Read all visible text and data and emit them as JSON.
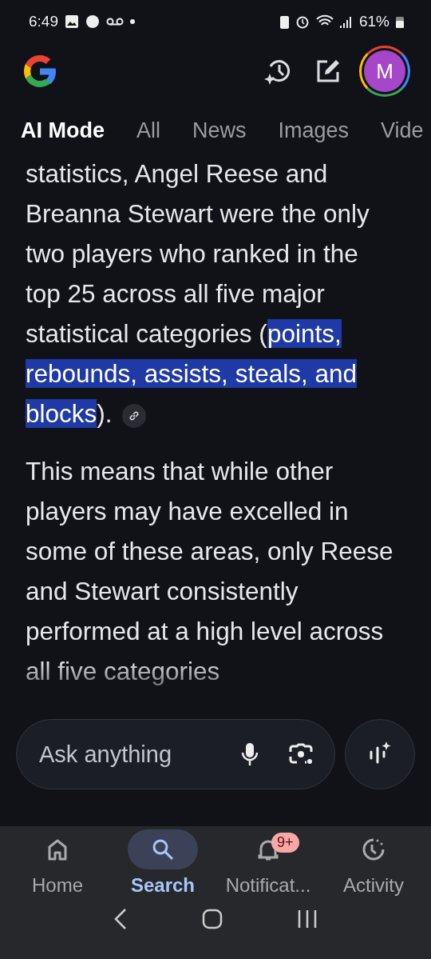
{
  "status_bar": {
    "time": "6:49",
    "battery": "61%"
  },
  "account": {
    "initial": "M"
  },
  "tabs": [
    {
      "label": "AI Mode",
      "selected": true
    },
    {
      "label": "All",
      "selected": false
    },
    {
      "label": "News",
      "selected": false
    },
    {
      "label": "Images",
      "selected": false
    },
    {
      "label": "Vide",
      "selected": false
    }
  ],
  "answer": {
    "paragraphs": [
      {
        "before": "statistics, Angel Reese and Breanna Stewart were the only two players who ranked in the top 25 across all five major statistical categories (",
        "highlight": "points, rebounds, assists, steals, and blocks",
        "after": ").",
        "link": true
      },
      {
        "before": "This means that while other players may have excelled in some of these areas, only Reese and Stewart consistently performed at a high level across all five categories",
        "link": false
      }
    ]
  },
  "search": {
    "placeholder": "Ask anything"
  },
  "bottom_nav": [
    {
      "kind": "home",
      "label": "Home",
      "selected": false
    },
    {
      "kind": "search",
      "label": "Search",
      "selected": true
    },
    {
      "kind": "bell",
      "label": "Notificat...",
      "selected": false,
      "badge": "9+"
    },
    {
      "kind": "activity",
      "label": "Activity",
      "selected": false
    }
  ]
}
